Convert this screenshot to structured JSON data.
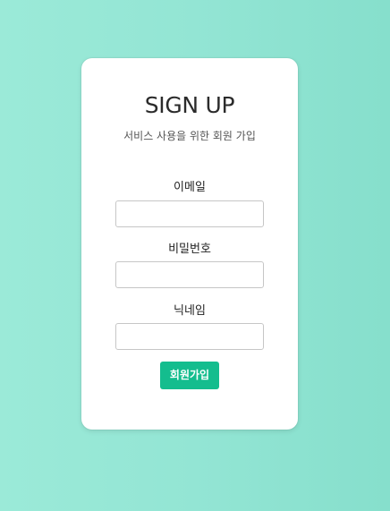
{
  "form": {
    "title": "SIGN UP",
    "subtitle": "서비스 사용을 위한 회원 가입",
    "fields": [
      {
        "label": "이메일",
        "value": "",
        "placeholder": ""
      },
      {
        "label": "비밀번호",
        "value": "",
        "placeholder": ""
      },
      {
        "label": "닉네임",
        "value": "",
        "placeholder": ""
      }
    ],
    "submit_label": "회원가입"
  },
  "colors": {
    "background_left": "#9bead8",
    "background_right": "#86dfcc",
    "card": "#ffffff",
    "accent": "#14bd8e"
  }
}
